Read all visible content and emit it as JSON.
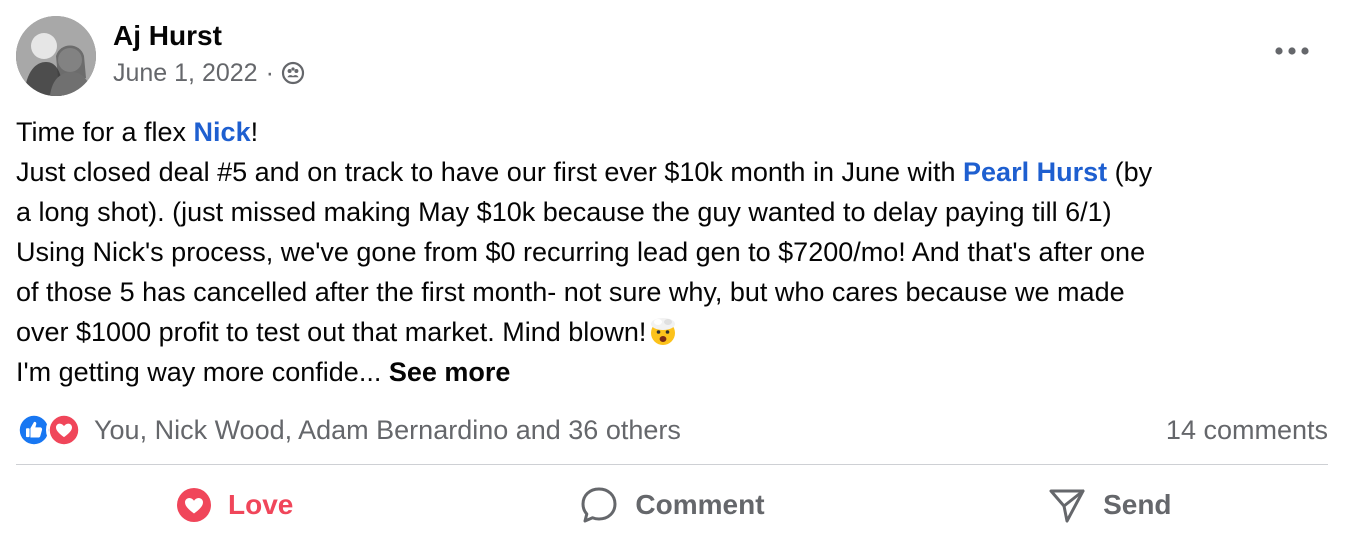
{
  "post": {
    "author": "Aj Hurst",
    "date": "June 1, 2022",
    "separator": "·",
    "audience_icon": "friends-globe-icon",
    "body": {
      "l1_a": "Time for a flex ",
      "l1_mention": "Nick",
      "l1_b": "!",
      "l2_a": "Just closed deal #5 and on track to have our first ever $10k month in June with ",
      "l2_mention": "Pearl Hurst",
      "l2_b": " (by",
      "l3": "a long shot). (just missed making May $10k because the guy wanted to delay paying till 6/1)",
      "l4": "Using Nick's process, we've gone from $0 recurring lead gen to $7200/mo! And that's after one",
      "l5": "of those 5 has cancelled after the first month- not sure why, but who cares because we made",
      "l6": "over $1000 profit to test out that market. Mind blown!",
      "l7": "I'm getting way more confide... ",
      "see_more": "See more"
    },
    "emoji": "exploding-head-emoji"
  },
  "reactions": {
    "icons": [
      "like-icon",
      "love-icon"
    ],
    "summary": "You, Nick Wood, Adam Bernardino and 36 others",
    "comments": "14 comments"
  },
  "actions": {
    "love": "Love",
    "comment": "Comment",
    "send": "Send"
  },
  "colors": {
    "mention": "#1e5fd0",
    "love": "#f0465a",
    "like": "#1877f2",
    "secondary_text": "#65676b"
  }
}
